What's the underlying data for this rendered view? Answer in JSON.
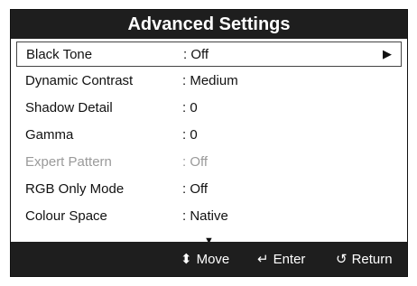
{
  "title": "Advanced Settings",
  "items": [
    {
      "label": "Black Tone",
      "value": ": Off",
      "selected": true,
      "has_arrow": true
    },
    {
      "label": "Dynamic Contrast",
      "value": ": Medium"
    },
    {
      "label": "Shadow Detail",
      "value": ": 0"
    },
    {
      "label": "Gamma",
      "value": ": 0"
    },
    {
      "label": "Expert Pattern",
      "value": ": Off",
      "disabled": true
    },
    {
      "label": "RGB Only Mode",
      "value": ": Off"
    },
    {
      "label": "Colour Space",
      "value": ": Native"
    }
  ],
  "icons": {
    "right_arrow": "▶",
    "scroll_down": "▼",
    "move": "⬍",
    "enter": "↵",
    "return": "↺"
  },
  "footer": {
    "move": "Move",
    "enter": "Enter",
    "return": "Return"
  }
}
